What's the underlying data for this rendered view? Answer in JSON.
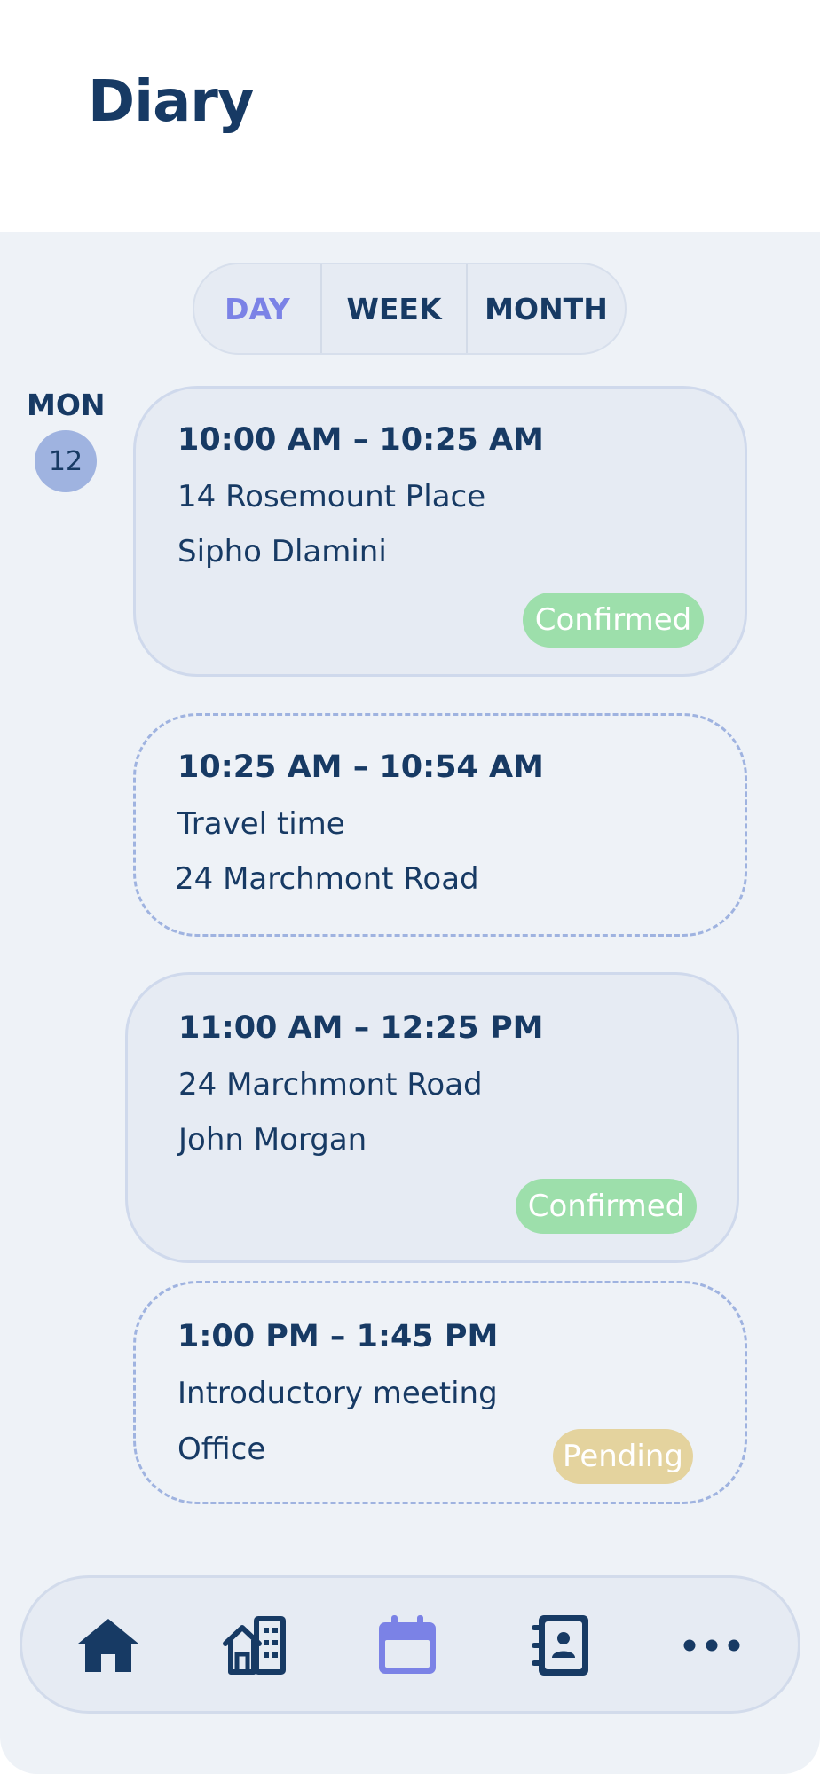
{
  "header": {
    "title": "Diary"
  },
  "view_switcher": {
    "options": [
      "DAY",
      "WEEK",
      "MONTH"
    ],
    "selected": "DAY"
  },
  "date": {
    "weekday": "MON",
    "day": "12"
  },
  "appointments": [
    {
      "time": "10:00 AM – 10:25 AM",
      "line1": "14 Rosemount Place",
      "line2": "Sipho Dlamini",
      "status": "Confirmed"
    },
    {
      "time": "10:25 AM – 10:54 AM",
      "line1": "Travel time",
      "line2": "24 Marchmont Road"
    },
    {
      "time": "11:00 AM – 12:25 PM",
      "line1": "24 Marchmont Road",
      "line2": "John Morgan",
      "status": "Confirmed"
    },
    {
      "time": "1:00 PM – 1:45 PM",
      "line1": "Introductory meeting",
      "line2": "Office",
      "status": "Pending"
    }
  ],
  "bottom_nav": {
    "items": [
      {
        "icon": "home-icon",
        "active": false
      },
      {
        "icon": "properties-icon",
        "active": false
      },
      {
        "icon": "calendar-icon",
        "active": true
      },
      {
        "icon": "contacts-icon",
        "active": false
      },
      {
        "icon": "more-icon",
        "active": false
      }
    ]
  },
  "colors": {
    "primary": "#173a64",
    "accent": "#7b82e6",
    "confirmed": "#9ddfab",
    "pending": "#e4d39e",
    "background": "#eef2f7"
  }
}
